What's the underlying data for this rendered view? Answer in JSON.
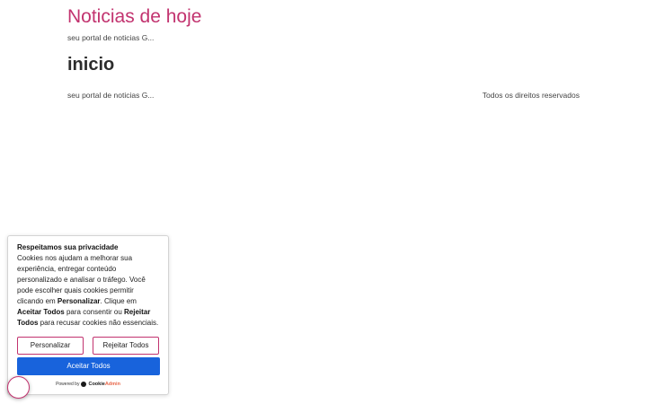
{
  "header": {
    "site_title": "Noticias de hoje",
    "tagline": "seu portal de noticias G..."
  },
  "main": {
    "heading": "inicio"
  },
  "footer": {
    "tagline": "seu portal de noticias G...",
    "rights": "Todos os direitos reservados"
  },
  "cookie_banner": {
    "title": "Respeitamos sua privacidade",
    "text_1": "Cookies nos ajudam a melhorar sua experiência, entregar conteúdo personalizado e analisar o tráfego. Você pode escolher quais cookies permitir clicando em ",
    "text_bold_1": "Personalizar",
    "text_2": ". Clique em ",
    "text_bold_2": "Aceitar Todos",
    "text_3": " para consentir ou ",
    "text_bold_3": "Rejeitar Todos",
    "text_4": " para recusar cookies não essenciais.",
    "customize_label": "Personalizar",
    "reject_label": "Rejeitar Todos",
    "accept_label": "Aceitar Todos",
    "powered_by": "Powered by",
    "brand_part_1": "Cookie",
    "brand_part_2": "Admin"
  },
  "colors": {
    "accent": "#c2336f",
    "primary_button": "#1863dc"
  },
  "icons": {
    "revisit": "cookie-revisit-icon",
    "brand": "cookieadmin-logo-icon"
  }
}
